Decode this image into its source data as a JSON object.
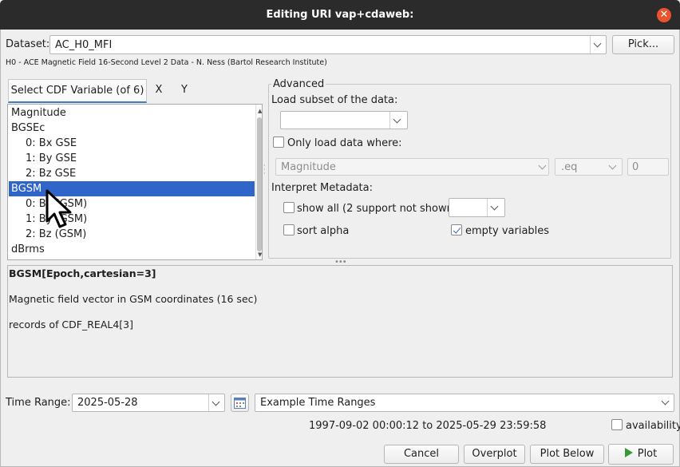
{
  "window": {
    "title": "Editing URI vap+cdaweb:"
  },
  "dataset": {
    "label": "Dataset:",
    "value": "AC_H0_MFI",
    "pick_label": "Pick...",
    "description": "H0 - ACE Magnetic Field 16-Second Level 2 Data - N. Ness (Bartol Research Institute)"
  },
  "tabs": [
    {
      "label": "Select CDF Variable (of 6)",
      "selected": true
    },
    {
      "label": "X",
      "selected": false
    },
    {
      "label": "Y",
      "selected": false
    }
  ],
  "variables": [
    {
      "label": "Magnitude",
      "indent": false,
      "selected": false
    },
    {
      "label": "BGSEc",
      "indent": false,
      "selected": false
    },
    {
      "label": "0: Bx GSE",
      "indent": true,
      "selected": false
    },
    {
      "label": "1: By GSE",
      "indent": true,
      "selected": false
    },
    {
      "label": "2: Bz GSE",
      "indent": true,
      "selected": false
    },
    {
      "label": "BGSM",
      "indent": false,
      "selected": true
    },
    {
      "label": "0: Bx (GSM)",
      "indent": true,
      "selected": false
    },
    {
      "label": "1: By (GSM)",
      "indent": true,
      "selected": false
    },
    {
      "label": "2: Bz (GSM)",
      "indent": true,
      "selected": false
    },
    {
      "label": "dBrms",
      "indent": false,
      "selected": false
    }
  ],
  "advanced": {
    "title": "Advanced",
    "load_subset_label": "Load subset of the data:",
    "subset_value": "",
    "only_load_label": "Only load data where:",
    "only_load_checked": false,
    "where_variable": "Magnitude",
    "where_op": ".eq",
    "where_value": "0",
    "interpret_label": "Interpret Metadata:",
    "show_all_label": "show all (2 support not shown)",
    "show_all_checked": false,
    "show_all_combo": "",
    "sort_alpha_label": "sort alpha",
    "sort_alpha_checked": false,
    "empty_vars_label": "empty variables",
    "empty_vars_checked": true
  },
  "info": {
    "line1": "BGSM[Epoch,cartesian=3]",
    "line2": "Magnetic field vector in GSM coordinates (16 sec)",
    "line3": "records of CDF_REAL4[3]"
  },
  "time": {
    "label": "Time Range:",
    "value": "2025-05-28",
    "examples": "Example Time Ranges",
    "range_text": "1997-09-02 00:00:12 to 2025-05-29 23:59:58",
    "availability_label": "availability",
    "availability_checked": false
  },
  "buttons": {
    "cancel": "Cancel",
    "overplot": "Overplot",
    "plot_below": "Plot Below",
    "plot": "Plot"
  },
  "colors": {
    "selection": "#2f65c8",
    "close": "#e9532f",
    "plot_icon": "#3a9a3a"
  }
}
